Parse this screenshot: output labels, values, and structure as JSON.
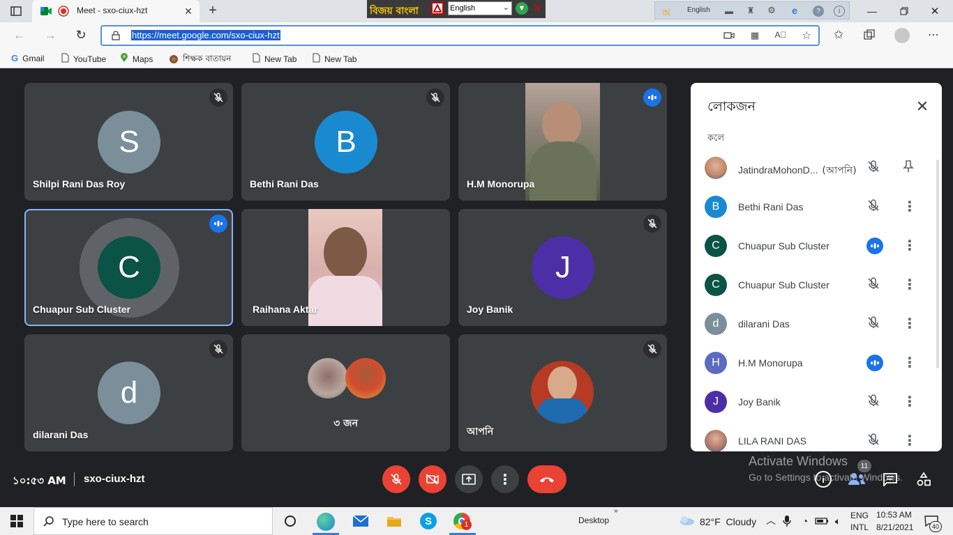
{
  "browser": {
    "tab_title": "Meet - sxo-ciux-hzt",
    "url": "https://meet.google.com/sxo-ciux-hzt",
    "keyboard_tool": {
      "brand": "বিজয় বাংলা",
      "language": "English"
    },
    "ime_bar": {
      "bn_char": "অ",
      "language": "English"
    }
  },
  "bookmarks": [
    {
      "label": "Gmail",
      "icon": "gmail-icon"
    },
    {
      "label": "YouTube",
      "icon": "page-icon"
    },
    {
      "label": "Maps",
      "icon": "maps-icon"
    },
    {
      "label": "শিক্ষক বাতায়ন",
      "icon": "bd-emblem-icon"
    },
    {
      "label": "New Tab",
      "icon": "page-icon"
    },
    {
      "label": "New Tab",
      "icon": "page-icon"
    }
  ],
  "tiles": [
    {
      "name": "Shilpi Rani Das Roy",
      "initial": "S",
      "color": "#7a8f99",
      "status": "muted"
    },
    {
      "name": "Bethi Rani Das",
      "initial": "B",
      "color": "#1a8ad0",
      "status": "muted"
    },
    {
      "name": "H.M Monorupa",
      "status": "talking"
    },
    {
      "name": "Chuapur Sub Cluster",
      "initial": "C",
      "color": "#0b5345",
      "status": "talking"
    },
    {
      "name": "Raihana Aktar",
      "status": "none"
    },
    {
      "name": "Joy Banik",
      "initial": "J",
      "color": "#4c2ea6",
      "status": "muted"
    },
    {
      "name": "dilarani Das",
      "initial": "d",
      "color": "#7a8f99",
      "status": "muted"
    },
    {
      "name": "৩ জন",
      "status": "none"
    },
    {
      "name": "আপনি",
      "status": "muted"
    }
  ],
  "panel": {
    "title": "লোকজন",
    "section": "কলে",
    "people": [
      {
        "name": "JatindraMohonD...",
        "suffix": "(আপনি)",
        "initial": "",
        "color": "#c28a6a",
        "mic": "muted",
        "action": "pin"
      },
      {
        "name": "Bethi Rani Das",
        "initial": "B",
        "color": "#1a8ad0",
        "mic": "muted",
        "action": "more"
      },
      {
        "name": "Chuapur Sub Cluster",
        "initial": "C",
        "color": "#0b5345",
        "mic": "talking",
        "action": "more"
      },
      {
        "name": "Chuapur Sub Cluster",
        "initial": "C",
        "color": "#0b5345",
        "mic": "muted",
        "action": "more"
      },
      {
        "name": "dilarani Das",
        "initial": "d",
        "color": "#7a8f99",
        "mic": "muted",
        "action": "more"
      },
      {
        "name": "H.M Monorupa",
        "initial": "H",
        "color": "#5b6bc0",
        "mic": "talking",
        "action": "more"
      },
      {
        "name": "Joy Banik",
        "initial": "J",
        "color": "#4c2ea6",
        "mic": "muted",
        "action": "more"
      },
      {
        "name": "LILA RANI DAS",
        "initial": "",
        "color": "#b07a6a",
        "mic": "muted",
        "action": "more"
      }
    ]
  },
  "bottom": {
    "time": "১০:৫৩ AM",
    "meeting_code": "sxo-ciux-hzt",
    "participant_count": "11",
    "watermark_line1": "Activate Windows",
    "watermark_line2": "Go to Settings to activate Windows."
  },
  "taskbar": {
    "search_placeholder": "Type here to search",
    "desktop_label": "Desktop",
    "weather": "82°F  Cloudy",
    "lang1": "ENG",
    "lang2": "INTL",
    "clock_time": "10:53 AM",
    "clock_date": "8/21/2021",
    "notification_count": "40",
    "chrome_badge": "1"
  },
  "colors": {
    "meet_bg": "#202124",
    "tile_bg": "#3c4043",
    "end_call": "#ea4335",
    "accent_blue": "#1a73e8"
  }
}
